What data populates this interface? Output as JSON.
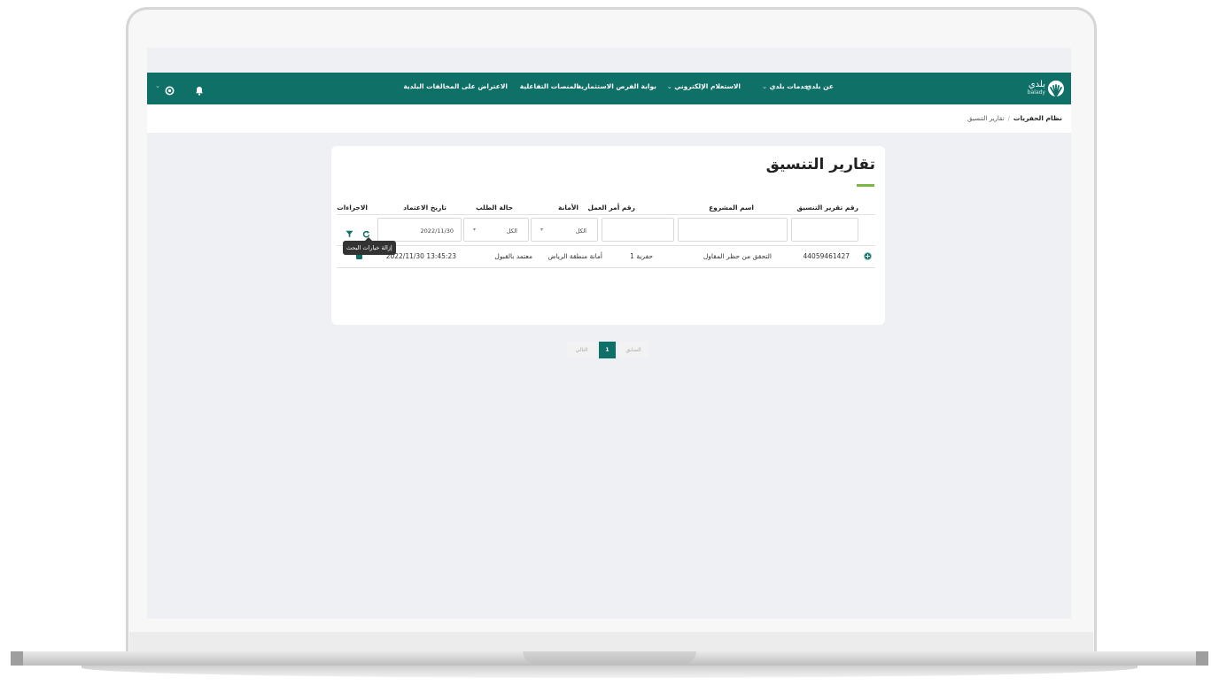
{
  "nav": {
    "logo_ar": "بلدي",
    "logo_en": "balady",
    "items": [
      {
        "label": "عن بلدي",
        "has_caret": false
      },
      {
        "label": "خدمات بلدي",
        "has_caret": true
      },
      {
        "label": "الاستعلام الإلكتروني",
        "has_caret": true
      },
      {
        "label": "بوابة الفرص الاستثمارية",
        "has_caret": false
      },
      {
        "label": "المنصات التفاعلية",
        "has_caret": false
      },
      {
        "label": "الاعتراض على المخالفات البلدية",
        "has_caret": false
      }
    ],
    "icons": [
      "bell-icon",
      "globe-icon",
      "chevron-down-icon"
    ]
  },
  "breadcrumb": {
    "root": "نظام الحفريات",
    "separator": "/",
    "current": "تقارير التنسيق"
  },
  "page": {
    "title": "تقارير التنسيق",
    "accent_color": "#7bb843",
    "primary_color": "#0e7067"
  },
  "table": {
    "headers": {
      "report_no": "رقم تقرير التنسيق",
      "project_name": "اسم المشروع",
      "work_order": "رقم أمر العمل",
      "amana": "الأمانة",
      "status": "حالة الطلب",
      "approval_date": "تاريخ الاعتماد",
      "actions": "الاجراءات"
    },
    "filters": {
      "report_no": "",
      "project_name": "",
      "work_order": "",
      "amana": "الكل",
      "status": "الكل",
      "approval_date": "2022/11/30"
    },
    "rows": [
      {
        "report_no": "44059461427",
        "project_name": "التحقق من حظر المقاول",
        "work_order": "حفرية 1",
        "amana": "أمانة منطقة الرياض",
        "status": "معتمد بالقبول",
        "approval_date": "2022/11/30 13:45:23"
      }
    ],
    "tooltip": "إزالة خيارات البحث"
  },
  "pagination": {
    "prev": "السابق",
    "current": "1",
    "next": "التالي"
  }
}
